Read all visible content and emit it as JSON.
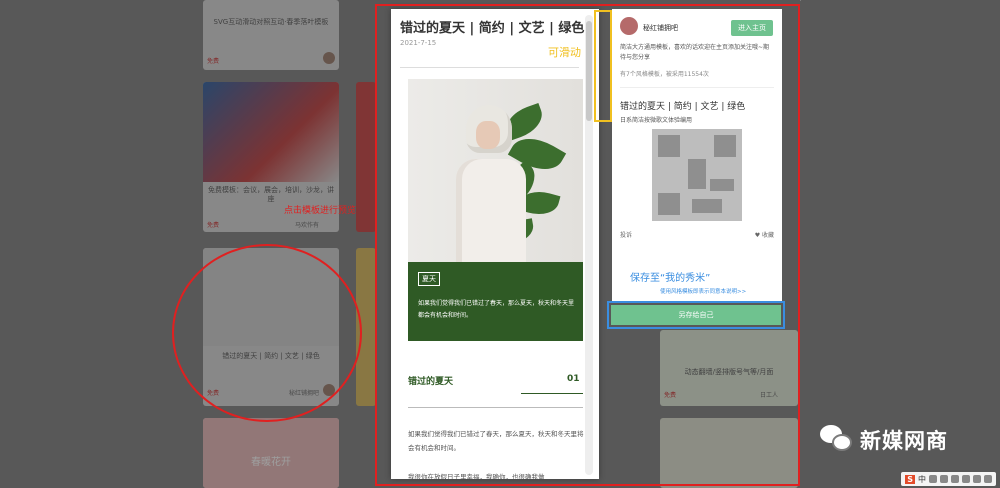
{
  "background_cards": [
    {
      "title": "SVG互动滑动对照互动·春季落叶模板",
      "free": "免费",
      "author": ""
    },
    {
      "title": "免费模板：会议，展会，培训，沙龙，讲座",
      "free": "免费",
      "author": "马欢作有"
    },
    {
      "title": "错过的夏天 | 简约 | 文艺 | 绿色",
      "free": "免费",
      "author": "秘红铺拥吧"
    },
    {
      "title": "动态翻墙/竖排版号气等/月面",
      "free": "免费",
      "author": "日工人"
    },
    {
      "title": "春暖花开",
      "free": "",
      "author": ""
    }
  ],
  "annotations": {
    "circle_note": "点击模板进行预览",
    "scroll_note": "可滑动"
  },
  "preview": {
    "title": "错过的夏天 | 简约 | 文艺 | 绿色",
    "date": "2021-7-15",
    "green_tag": "夏天",
    "green_text": "如果我们觉得我们已错过了春天，那么夏天，秋天和冬天里都会有机会和时间。",
    "section_title": "错过的夏天",
    "section_num": "01",
    "paragraph": "如果我们觉得我们已错过了春天，那么夏天，秋天和冬天里将会有机会和时间。",
    "paragraph2": "我很你在放假日子里幸福，我确你，也很确我做"
  },
  "side_panel": {
    "username": "秘红铺拥吧",
    "enter_button": "进入主页",
    "description": "简洁大方通用模板，喜欢的话欢迎在主页添加关注哦~期待与您分享",
    "stats": "有7个风格模板，被采用11554次",
    "template_title": "错过的夏天 | 简约 | 文艺 | 绿色",
    "template_sub": "日系简洁按微歌文体验编用",
    "report": "投诉",
    "favorite": "♥ 收藏",
    "save_link": "保存至“我的秀米”",
    "hint": "使用风格模板即表示同意本说明>>",
    "save_button": "另存给自己"
  },
  "watermark": "新媒网商",
  "ime_bar": {
    "logo": "S",
    "lang": "中"
  }
}
